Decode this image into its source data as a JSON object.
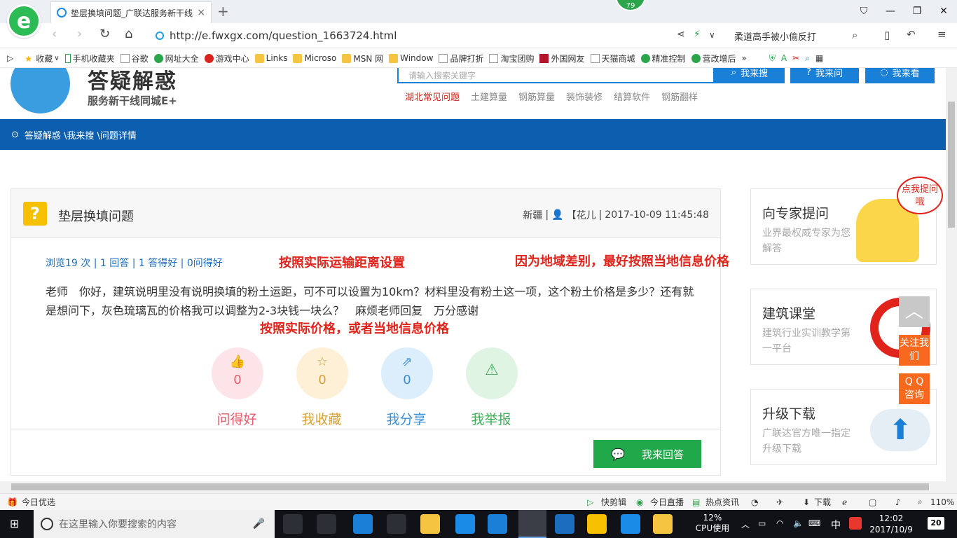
{
  "browser": {
    "tab_title": "垫层换填问题_广联达服务新干线",
    "tab_close": "×",
    "new_tab": "+",
    "badge": "79",
    "url": "http://e.fwxgx.com/question_1663724.html",
    "search_text": "柔道高手被小偷反打",
    "bookmarks": [
      "收藏",
      "手机收藏夹",
      "谷歌",
      "网址大全",
      "游戏中心",
      "Links",
      "Microso",
      "MSN 网",
      "Window",
      "品牌打折",
      "淘宝团购",
      "外国网友",
      "天猫商城",
      "精准控制",
      "营改增后"
    ],
    "bookmarks_more": "»"
  },
  "site": {
    "logo_title": "答疑解惑",
    "logo_subtitle": "服务新干线同城E+",
    "search_placeholder": "请输入搜索关键字",
    "btn_search": "我来搜",
    "btn_ask": "我来问",
    "btn_view": "我来看",
    "hot_links": [
      "湖北常见问题",
      "土建算量",
      "钢筋算量",
      "装饰装修",
      "结算软件",
      "钢筋翻样"
    ],
    "breadcrumb": "答疑解惑 \\我来搜 \\问题详情"
  },
  "question": {
    "title": "垫层换填问题",
    "region": "新疆",
    "user": "【花儿",
    "datetime": "2017-10-09 11:45:48",
    "stats": "浏览19 次 | 1 回答 | 1 答得好 | 0问得好",
    "body": "老师　你好，建筑说明里没有说明换填的粉土运距，可不可以设置为10km？材料里没有粉土这一项，这个粉土价格是多少？还有就是想问下，灰色琉璃瓦的价格我可以调整为2-3块钱一块么？　麻烦老师回复　万分感谢",
    "annotation_1": "按照实际运输距离设置",
    "annotation_2": "因为地域差别，最好按照当地信息价格",
    "annotation_3": "按照实际价格，或者当地信息价格",
    "actions": [
      {
        "label": "问得好",
        "count": "0",
        "color": "#e85c6a",
        "bg": "#fde4e8"
      },
      {
        "label": "我收藏",
        "count": "0",
        "color": "#d9a23a",
        "bg": "#fdf0d6"
      },
      {
        "label": "我分享",
        "count": "0",
        "color": "#3a8fd9",
        "bg": "#dcedfb"
      },
      {
        "label": "我举报",
        "count": "",
        "color": "#3fae5a",
        "bg": "#e0f4e4"
      }
    ],
    "answer_btn": "我来回答"
  },
  "sidebar": {
    "card1_title": "向专家提问",
    "card1_sub": "业界最权威专家为您解答",
    "card1_bubble": "点我提问哦",
    "card2_title": "建筑课堂",
    "card2_sub": "建筑行业实训教学第一平台",
    "card3_title": "升级下载",
    "card3_sub": "广联达官方唯一指定升级下载",
    "follow": "关注我们",
    "qq": "Q Q 咨询"
  },
  "statusbar": {
    "left": "今日优选",
    "items": [
      "快剪辑",
      "今日直播",
      "热点资讯",
      "下载"
    ],
    "zoom": "110%"
  },
  "taskbar": {
    "search_placeholder": "在这里输入你要搜索的内容",
    "cpu_pct": "12%",
    "cpu_label": "CPU使用",
    "ime": "中",
    "time": "12:02",
    "date": "2017/10/9",
    "notif": "20"
  }
}
